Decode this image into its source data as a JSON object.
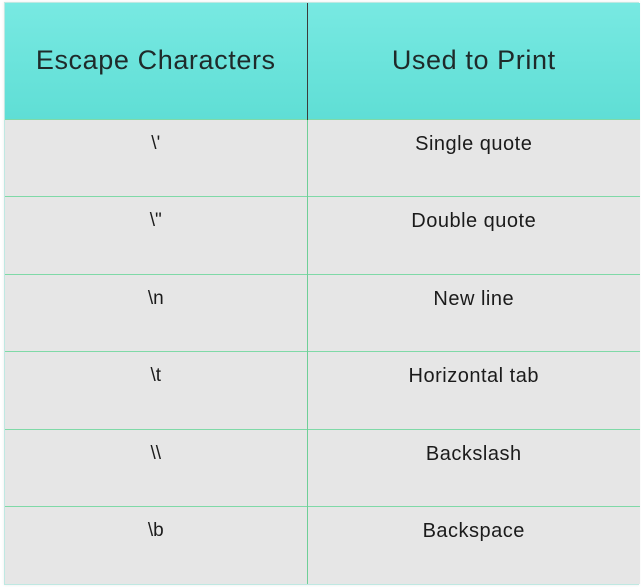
{
  "table": {
    "headers": [
      "Escape Characters",
      "Used to Print"
    ],
    "rows": [
      {
        "escape": "\\'",
        "meaning": "Single quote"
      },
      {
        "escape": "\\\"",
        "meaning": "Double quote"
      },
      {
        "escape": "\\n",
        "meaning": "New line"
      },
      {
        "escape": "\\t",
        "meaning": "Horizontal tab"
      },
      {
        "escape": "\\\\",
        "meaning": "Backslash"
      },
      {
        "escape": "\\b",
        "meaning": "Backspace"
      }
    ]
  },
  "colors": {
    "header_bg": "#5fe2da",
    "row_bg": "#e6e6e6",
    "grid_line": "#7fd9a7"
  }
}
